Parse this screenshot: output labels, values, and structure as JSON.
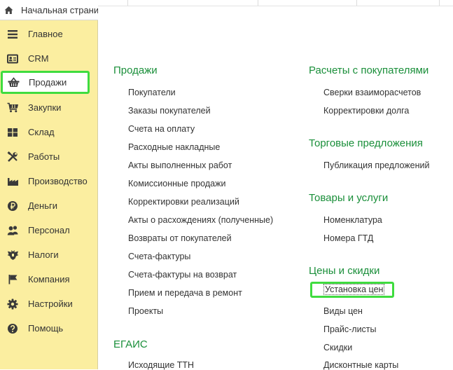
{
  "tab": {
    "label": "Начальная страница"
  },
  "sidebar": {
    "items": [
      {
        "label": "Главное",
        "icon": "menu-lines-icon"
      },
      {
        "label": "CRM",
        "icon": "contact-card-icon"
      },
      {
        "label": "Продажи",
        "icon": "basket-icon"
      },
      {
        "label": "Закупки",
        "icon": "cart-icon"
      },
      {
        "label": "Склад",
        "icon": "warehouse-grid-icon"
      },
      {
        "label": "Работы",
        "icon": "tools-icon"
      },
      {
        "label": "Производство",
        "icon": "factory-icon"
      },
      {
        "label": "Деньги",
        "icon": "ruble-coin-icon"
      },
      {
        "label": "Персонал",
        "icon": "people-icon"
      },
      {
        "label": "Налоги",
        "icon": "eagle-emblem-icon"
      },
      {
        "label": "Компания",
        "icon": "flag-icon"
      },
      {
        "label": "Настройки",
        "icon": "gear-icon"
      },
      {
        "label": "Помощь",
        "icon": "help-icon"
      }
    ]
  },
  "sections": {
    "sales": {
      "title": "Продажи",
      "links": [
        "Покупатели",
        "Заказы покупателей",
        "Счета на оплату",
        "Расходные накладные",
        "Акты выполненных работ",
        "Комиссионные продажи",
        "Корректировки реализаций",
        "Акты о расхождениях (полученные)",
        "Возвраты от покупателей",
        "Счета-фактуры",
        "Счета-фактуры на возврат",
        "Прием и передача в ремонт",
        "Проекты"
      ]
    },
    "egais": {
      "title": "ЕГАИС",
      "links": [
        "Исходящие ТТН"
      ]
    },
    "settlements": {
      "title": "Расчеты с покупателями",
      "links": [
        "Сверки взаиморасчетов",
        "Корректировки долга"
      ]
    },
    "offers": {
      "title": "Торговые предложения",
      "links": [
        "Публикация предложений"
      ]
    },
    "goods": {
      "title": "Товары и услуги",
      "links": [
        "Номенклатура",
        "Номера ГТД"
      ]
    },
    "prices": {
      "title": "Цены и скидки",
      "links": [
        "Установка цен",
        "Виды цен",
        "Прайс-листы",
        "Скидки",
        "Дисконтные карты"
      ]
    }
  },
  "colors": {
    "sidebar_bg": "#fbeea0",
    "section_title": "#1a8f3a",
    "highlight": "#3fdc3f",
    "text": "#333333"
  }
}
